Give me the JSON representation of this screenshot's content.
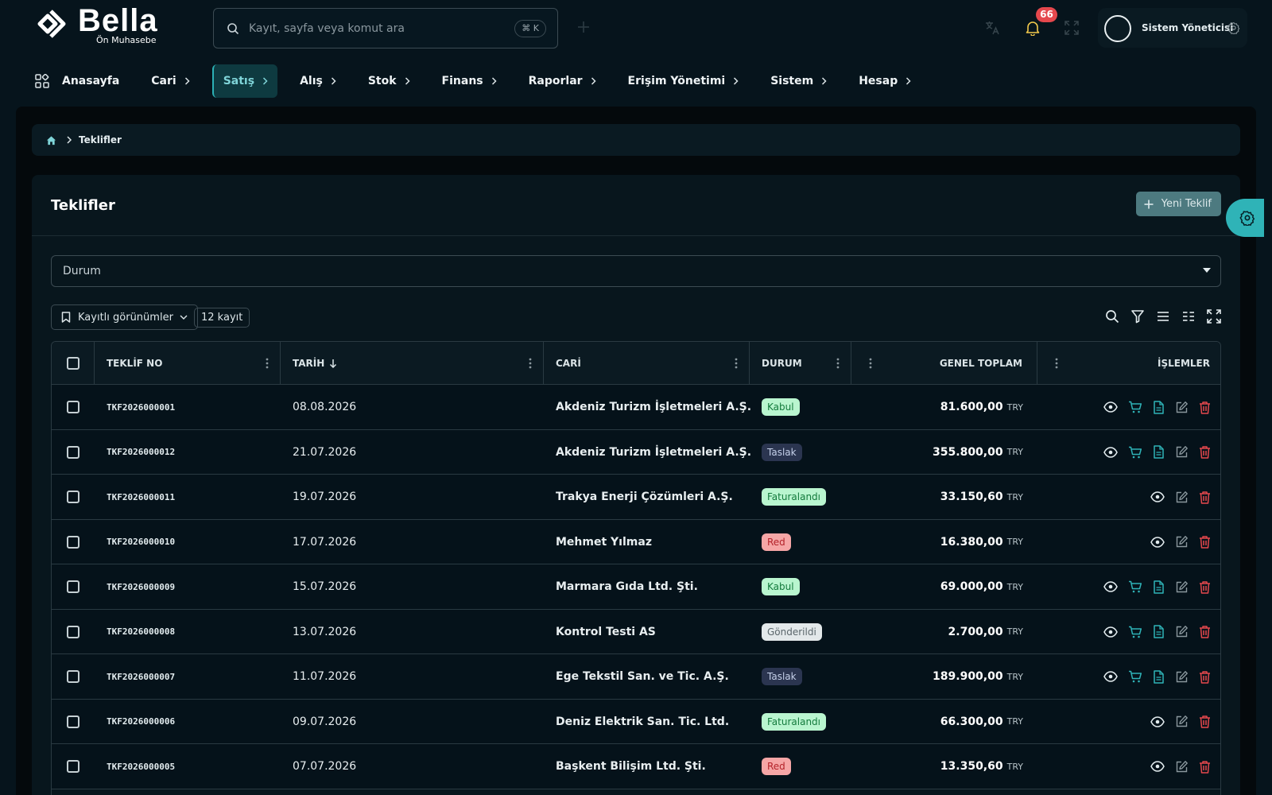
{
  "app": {
    "logo_name": "Bella",
    "logo_sub": "Ön Muhasebe"
  },
  "search": {
    "placeholder": "Kayıt, sayfa veya komut ara",
    "shortcut": "⌘ K"
  },
  "notifications": {
    "count": "66"
  },
  "user": {
    "name": "Sistem Yöneticisi"
  },
  "nav": {
    "home": "Anasayfa",
    "items": [
      {
        "label": "Cari"
      },
      {
        "label": "Satış",
        "active": true
      },
      {
        "label": "Alış"
      },
      {
        "label": "Stok"
      },
      {
        "label": "Finans"
      },
      {
        "label": "Raporlar"
      },
      {
        "label": "Erişim Yönetimi"
      },
      {
        "label": "Sistem"
      },
      {
        "label": "Hesap"
      }
    ]
  },
  "breadcrumb": {
    "current": "Teklifler"
  },
  "page": {
    "title": "Teklifler",
    "new_button": "Yeni Teklif"
  },
  "filter": {
    "status_label": "Durum"
  },
  "toolbar": {
    "saved_views": "Kayıtlı görünümler",
    "record_count": "12 kayıt"
  },
  "table": {
    "columns": {
      "no": "TEKLİF NO",
      "date": "TARİH",
      "cari": "CARİ",
      "status": "DURUM",
      "total": "GENEL TOPLAM",
      "actions": "İŞLEMLER"
    },
    "currency": "TRY",
    "rows": [
      {
        "no": "TKF2026000001",
        "date": "08.08.2026",
        "cari": "Akdeniz Turizm İşletmeleri A.Ş.",
        "status": "Kabul",
        "total": "81.600,00",
        "full_actions": true
      },
      {
        "no": "TKF2026000012",
        "date": "21.07.2026",
        "cari": "Akdeniz Turizm İşletmeleri A.Ş.",
        "status": "Taslak",
        "total": "355.800,00",
        "full_actions": true
      },
      {
        "no": "TKF2026000011",
        "date": "19.07.2026",
        "cari": "Trakya Enerji Çözümleri A.Ş.",
        "status": "Faturalandı",
        "total": "33.150,60",
        "full_actions": false
      },
      {
        "no": "TKF2026000010",
        "date": "17.07.2026",
        "cari": "Mehmet Yılmaz",
        "status": "Red",
        "total": "16.380,00",
        "full_actions": false
      },
      {
        "no": "TKF2026000009",
        "date": "15.07.2026",
        "cari": "Marmara Gıda Ltd. Şti.",
        "status": "Kabul",
        "total": "69.000,00",
        "full_actions": true
      },
      {
        "no": "TKF2026000008",
        "date": "13.07.2026",
        "cari": "Kontrol Testi AS",
        "status": "Gönderildi",
        "total": "2.700,00",
        "full_actions": true
      },
      {
        "no": "TKF2026000007",
        "date": "11.07.2026",
        "cari": "Ege Tekstil San. ve Tic. A.Ş.",
        "status": "Taslak",
        "total": "189.900,00",
        "full_actions": true
      },
      {
        "no": "TKF2026000006",
        "date": "09.07.2026",
        "cari": "Deniz Elektrik San. Tic. Ltd.",
        "status": "Faturalandı",
        "total": "66.300,00",
        "full_actions": false
      },
      {
        "no": "TKF2026000005",
        "date": "07.07.2026",
        "cari": "Başkent Bilişim Ltd. Şti.",
        "status": "Red",
        "total": "13.350,60",
        "full_actions": false
      }
    ]
  },
  "status_colors": {
    "Kabul": {
      "bg": "#b9f5cf",
      "fg": "#137a3c"
    },
    "Taslak": {
      "bg": "#2b3550",
      "fg": "#c6d1ea"
    },
    "Faturalandı": {
      "bg": "#b9f5cf",
      "fg": "#137a3c"
    },
    "Red": {
      "bg": "#f6a6a6",
      "fg": "#b4232a"
    },
    "Gönderildi": {
      "bg": "#e3e8ea",
      "fg": "#5b666b"
    }
  },
  "colors": {
    "accent": "#2fb3b7",
    "danger": "#e5484d",
    "background": "#06141c"
  }
}
